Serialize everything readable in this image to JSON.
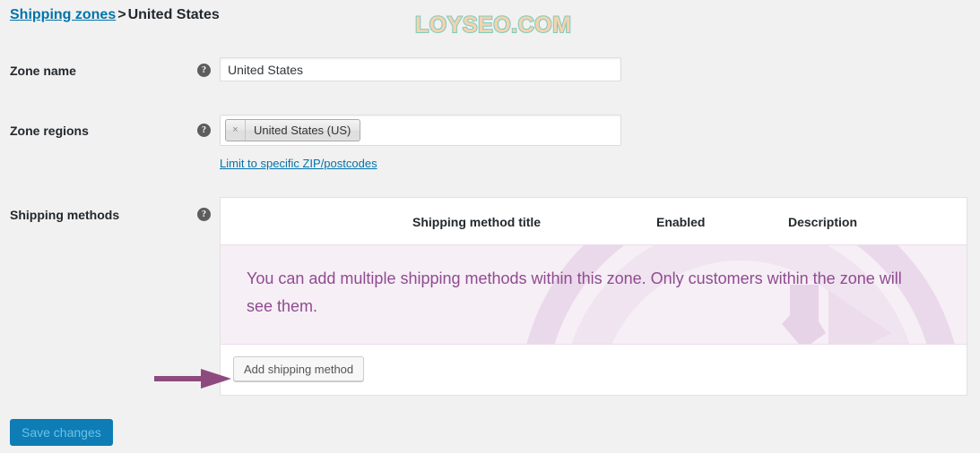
{
  "watermark": "LOYSEO.COM",
  "breadcrumb": {
    "link_label": "Shipping zones",
    "separator": ">",
    "current": "United States"
  },
  "form": {
    "zone_name": {
      "label": "Zone name",
      "help_icon": "help-icon",
      "help_glyph": "?",
      "value": "United States",
      "placeholder": "Zone name"
    },
    "zone_regions": {
      "label": "Zone regions",
      "help_icon": "help-icon",
      "help_glyph": "?",
      "chips": [
        {
          "label": "United States (US)",
          "remove_glyph": "×"
        }
      ],
      "zip_link": "Limit to specific ZIP/postcodes"
    },
    "shipping_methods": {
      "label": "Shipping methods",
      "help_icon": "help-icon",
      "help_glyph": "?",
      "columns": [
        "Shipping method title",
        "Enabled",
        "Description"
      ],
      "empty_message": "You can add multiple shipping methods within this zone. Only customers within the zone will see them.",
      "add_button": "Add shipping method"
    }
  },
  "footer": {
    "save_label": "Save changes"
  },
  "colors": {
    "page_bg": "#f1f1f1",
    "link": "#0073aa",
    "empty_bg": "#f6eff6",
    "empty_text": "#8f4b8f",
    "annotation_arrow": "#8e4a7e",
    "save_button_bg": "#0e7cb5",
    "save_button_text": "#6cc2e6",
    "watermark_fill": "#f3d3ae",
    "watermark_stroke": "#7ecabf"
  }
}
